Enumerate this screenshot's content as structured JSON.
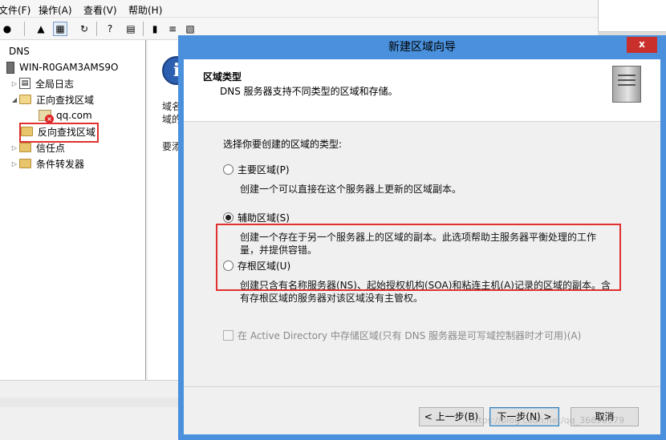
{
  "menu": {
    "file": "文件(F)",
    "action": "操作(A)",
    "view": "查看(V)",
    "help": "帮助(H)"
  },
  "tree": {
    "root": "DNS",
    "server": "WIN-R0GAM3AMS9O",
    "items": [
      {
        "label": "全局日志"
      },
      {
        "label": "正向查找区域"
      },
      {
        "label": "qq.com"
      },
      {
        "label": "反向查找区域"
      },
      {
        "label": "信任点"
      },
      {
        "label": "条件转发器"
      }
    ]
  },
  "right_pane": {
    "line1": "域名",
    "line2": "域的",
    "line3": "要添"
  },
  "wizard": {
    "title": "新建区域向导",
    "close": "x",
    "header": {
      "title": "区域类型",
      "subtitle": "DNS 服务器支持不同类型的区域和存储。"
    },
    "prompt": "选择你要创建的区域的类型:",
    "options": [
      {
        "label": "主要区域(P)",
        "checked": false,
        "desc": [
          "创建一个可以直接在这个服务器上更新的区域副本。"
        ]
      },
      {
        "label": "辅助区域(S)",
        "checked": true,
        "desc": [
          "创建一个存在于另一个服务器上的区域的副本。此选项帮助主服务器平衡处理的工作",
          "量，并提供容错。"
        ]
      },
      {
        "label": "存根区域(U)",
        "checked": false,
        "desc": [
          "创建只含有名称服务器(NS)、起始授权机构(SOA)和粘连主机(A)记录的区域的副本。含",
          "有存根区域的服务器对该区域没有主管权。"
        ]
      }
    ],
    "ad_checkbox": {
      "label": "在 Active Directory 中存储区域(只有 DNS 服务器是可写域控制器时才可用)(A)",
      "checked": false,
      "enabled": false
    },
    "buttons": {
      "back": "< 上一步(B)",
      "next": "下一步(N) >",
      "cancel": "取消"
    }
  },
  "watermark": "https://blog.csdn.net/qq_36690579",
  "colors": {
    "titlebar": "#4a90dc",
    "close": "#c9302c",
    "highlight_box": "#e03030"
  }
}
